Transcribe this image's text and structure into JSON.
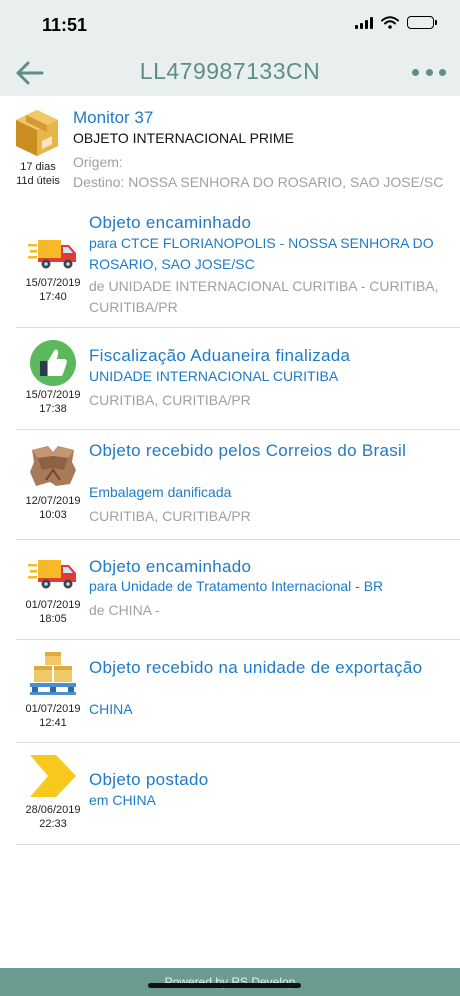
{
  "status_bar": {
    "time": "11:51"
  },
  "nav": {
    "title": "LL479987133CN"
  },
  "header": {
    "name": "Monitor 37",
    "type": "OBJETO INTERNACIONAL PRIME",
    "days": "17 dias",
    "business_days": "11d úteis",
    "origin": "Origem:",
    "destination": "Destino: NOSSA SENHORA DO ROSARIO, SAO JOSE/SC"
  },
  "events": [
    {
      "icon": "truck-icon",
      "date": "15/07/2019",
      "time": "17:40",
      "title": "Objeto encaminhado",
      "subtitle": "para CTCE FLORIANOPOLIS - NOSSA SENHORA DO ROSARIO, SAO JOSE/SC",
      "location": "de UNIDADE INTERNACIONAL CURITIBA - CURITIBA, CURITIBA/PR"
    },
    {
      "icon": "thumbs-up-icon",
      "date": "15/07/2019",
      "time": "17:38",
      "title": "Fiscalização Aduaneira finalizada",
      "subtitle": "UNIDADE INTERNACIONAL CURITIBA",
      "location": "CURITIBA, CURITIBA/PR"
    },
    {
      "icon": "damaged-box-icon",
      "date": "12/07/2019",
      "time": "10:03",
      "title": "Objeto recebido pelos Correios do Brasil",
      "subtitle": "Embalagem danificada",
      "location": "CURITIBA, CURITIBA/PR"
    },
    {
      "icon": "truck-icon",
      "date": "01/07/2019",
      "time": "18:05",
      "title": "Objeto encaminhado",
      "subtitle": "para Unidade de Tratamento Internacional - BR",
      "location": "de CHINA -"
    },
    {
      "icon": "boxes-pallet-icon",
      "date": "01/07/2019",
      "time": "12:41",
      "title": "Objeto recebido na unidade de exportação",
      "subtitle": "CHINA",
      "location": ""
    },
    {
      "icon": "chevron-post-icon",
      "date": "28/06/2019",
      "time": "22:33",
      "title": "Objeto postado",
      "subtitle": "em CHINA",
      "location": ""
    }
  ],
  "footer": {
    "text": "Powered by RS Develop"
  },
  "colors": {
    "bar_bg": "#e8efee",
    "accent": "#5e8e85",
    "link_blue": "#1f7bc7",
    "footer_bg": "#6b9b91"
  }
}
